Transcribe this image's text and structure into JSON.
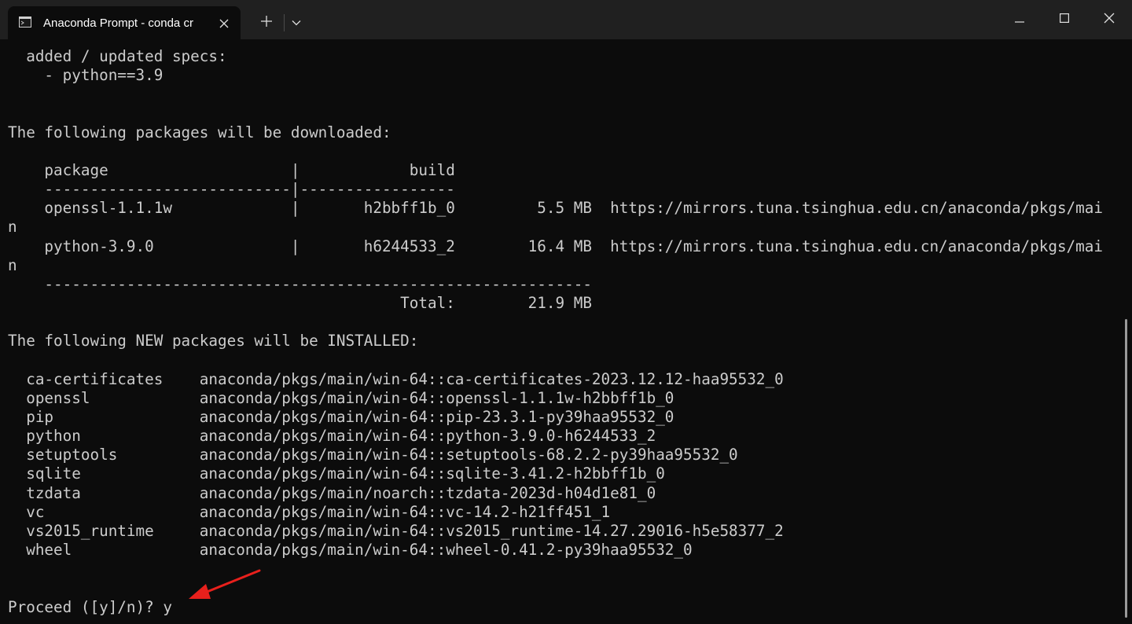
{
  "window": {
    "tab_title": "Anaconda Prompt - conda  cr",
    "icons": {
      "tab": "terminal-icon",
      "close_tab": "close-icon",
      "new_tab": "plus-icon",
      "dropdown": "chevron-down-icon",
      "minimize": "minimize-icon",
      "maximize": "maximize-icon",
      "close_window": "close-icon"
    }
  },
  "colors": {
    "background": "#0c0c0c",
    "titlebar": "#202020",
    "text": "#cccccc",
    "annotation_arrow": "#e8201c"
  },
  "terminal": {
    "lines": [
      "  added / updated specs:",
      "    - python==3.9",
      "",
      "",
      "The following packages will be downloaded:",
      "",
      "    package                    |            build",
      "    ---------------------------|-----------------",
      "    openssl-1.1.1w             |       h2bbff1b_0         5.5 MB  https://mirrors.tuna.tsinghua.edu.cn/anaconda/pkgs/mai",
      "n",
      "    python-3.9.0               |       h6244533_2        16.4 MB  https://mirrors.tuna.tsinghua.edu.cn/anaconda/pkgs/mai",
      "n",
      "    ------------------------------------------------------------",
      "                                           Total:        21.9 MB",
      "",
      "The following NEW packages will be INSTALLED:",
      "",
      "  ca-certificates    anaconda/pkgs/main/win-64::ca-certificates-2023.12.12-haa95532_0",
      "  openssl            anaconda/pkgs/main/win-64::openssl-1.1.1w-h2bbff1b_0",
      "  pip                anaconda/pkgs/main/win-64::pip-23.3.1-py39haa95532_0",
      "  python             anaconda/pkgs/main/win-64::python-3.9.0-h6244533_2",
      "  setuptools         anaconda/pkgs/main/win-64::setuptools-68.2.2-py39haa95532_0",
      "  sqlite             anaconda/pkgs/main/win-64::sqlite-3.41.2-h2bbff1b_0",
      "  tzdata             anaconda/pkgs/main/noarch::tzdata-2023d-h04d1e81_0",
      "  vc                 anaconda/pkgs/main/win-64::vc-14.2-h21ff451_1",
      "  vs2015_runtime     anaconda/pkgs/main/win-64::vs2015_runtime-14.27.29016-h5e58377_2",
      "  wheel              anaconda/pkgs/main/win-64::wheel-0.41.2-py39haa95532_0",
      "",
      "",
      "Proceed ([y]/n)? y"
    ]
  }
}
